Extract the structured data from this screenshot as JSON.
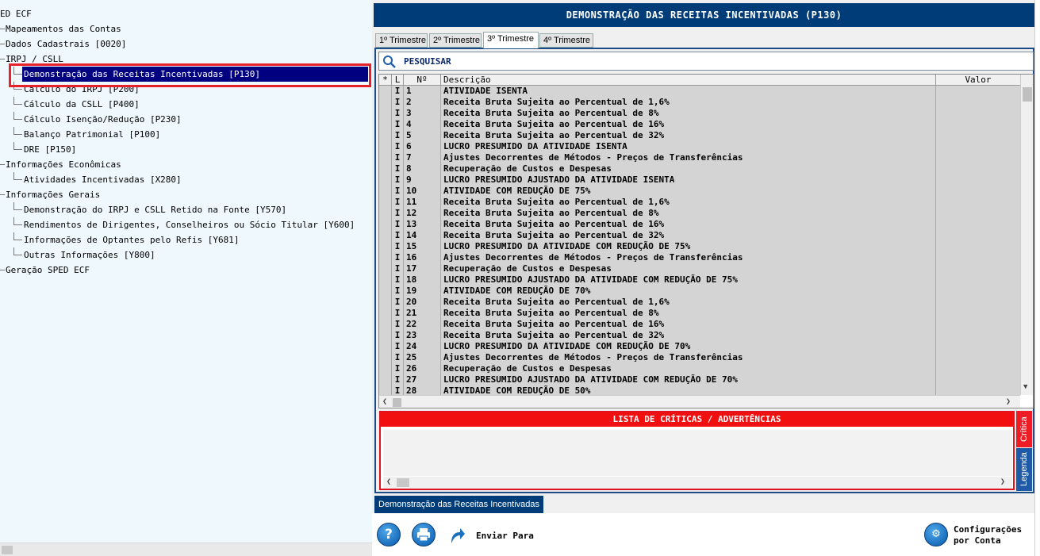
{
  "tree": {
    "nodes": [
      {
        "label": "ED ECF",
        "indent": 0
      },
      {
        "label": "Mapeamentos das Contas",
        "indent": 1
      },
      {
        "label": "Dados Cadastrais [0020]",
        "indent": 1
      },
      {
        "label": "IRPJ / CSLL",
        "indent": 1
      },
      {
        "label": "Demonstração das Receitas Incentivadas [P130]",
        "indent": 2,
        "selected": true
      },
      {
        "label": "Cálculo do IRPJ [P200]",
        "indent": 2
      },
      {
        "label": "Cálculo da CSLL [P400]",
        "indent": 2
      },
      {
        "label": "Cálculo Isenção/Redução [P230]",
        "indent": 2
      },
      {
        "label": "Balanço Patrimonial [P100]",
        "indent": 2
      },
      {
        "label": "DRE [P150]",
        "indent": 2
      },
      {
        "label": "Informações Econômicas",
        "indent": 1
      },
      {
        "label": "Atividades Incentivadas [X280]",
        "indent": 2
      },
      {
        "label": "Informações Gerais",
        "indent": 1
      },
      {
        "label": "Demonstração do IRPJ e CSLL Retido na Fonte [Y570]",
        "indent": 2
      },
      {
        "label": "Rendimentos de Dirigentes, Conselheiros ou Sócio Titular [Y600]",
        "indent": 2
      },
      {
        "label": "Informações de Optantes pelo Refis [Y681]",
        "indent": 2
      },
      {
        "label": "Outras Informações [Y800]",
        "indent": 2
      },
      {
        "label": "Geração SPED ECF",
        "indent": 1
      }
    ]
  },
  "panel": {
    "title": "DEMONSTRAÇÃO DAS RECEITAS INCENTIVADAS  (P130)",
    "tabs": [
      "1º Trimestre",
      "2º Trimestre",
      "3º Trimestre",
      "4º Trimestre"
    ],
    "active_tab_index": 2,
    "search_label": "PESQUISAR",
    "grid": {
      "headers": {
        "star": "*",
        "l": "L",
        "n": "Nº",
        "desc": "Descrição",
        "valor": "Valor"
      },
      "rows": [
        {
          "l": "I",
          "n": "1",
          "desc": "ATIVIDADE ISENTA"
        },
        {
          "l": "I",
          "n": "2",
          "desc": "Receita Bruta Sujeita ao Percentual de 1,6%"
        },
        {
          "l": "I",
          "n": "3",
          "desc": "Receita Bruta Sujeita ao Percentual de 8%"
        },
        {
          "l": "I",
          "n": "4",
          "desc": "Receita Bruta Sujeita ao Percentual de 16%"
        },
        {
          "l": "I",
          "n": "5",
          "desc": "Receita Bruta Sujeita ao Percentual de 32%"
        },
        {
          "l": "I",
          "n": "6",
          "desc": "LUCRO PRESUMIDO DA ATIVIDADE ISENTA"
        },
        {
          "l": "I",
          "n": "7",
          "desc": "Ajustes Decorrentes de Métodos - Preços de Transferências"
        },
        {
          "l": "I",
          "n": "8",
          "desc": "Recuperação de Custos e Despesas"
        },
        {
          "l": "I",
          "n": "9",
          "desc": "LUCRO PRESUMIDO AJUSTADO DA ATIVIDADE ISENTA"
        },
        {
          "l": "I",
          "n": "10",
          "desc": "ATIVIDADE COM REDUÇÃO DE 75%"
        },
        {
          "l": "I",
          "n": "11",
          "desc": "Receita Bruta Sujeita ao Percentual de 1,6%"
        },
        {
          "l": "I",
          "n": "12",
          "desc": "Receita Bruta Sujeita ao Percentual de 8%"
        },
        {
          "l": "I",
          "n": "13",
          "desc": "Receita Bruta Sujeita ao Percentual de 16%"
        },
        {
          "l": "I",
          "n": "14",
          "desc": "Receita Bruta Sujeita ao Percentual de 32%"
        },
        {
          "l": "I",
          "n": "15",
          "desc": "LUCRO PRESUMIDO DA ATIVIDADE COM REDUÇÃO DE 75%"
        },
        {
          "l": "I",
          "n": "16",
          "desc": "Ajustes Decorrentes de Métodos - Preços de Transferências"
        },
        {
          "l": "I",
          "n": "17",
          "desc": "Recuperação de Custos e Despesas"
        },
        {
          "l": "I",
          "n": "18",
          "desc": "LUCRO PRESUMIDO AJUSTADO DA ATIVIDADE COM REDUÇÃO DE 75%"
        },
        {
          "l": "I",
          "n": "19",
          "desc": "ATIVIDADE COM REDUÇÃO DE 70%"
        },
        {
          "l": "I",
          "n": "20",
          "desc": "Receita Bruta Sujeita ao Percentual de 1,6%"
        },
        {
          "l": "I",
          "n": "21",
          "desc": "Receita Bruta Sujeita ao Percentual de 8%"
        },
        {
          "l": "I",
          "n": "22",
          "desc": "Receita Bruta Sujeita ao Percentual de 16%"
        },
        {
          "l": "I",
          "n": "23",
          "desc": "Receita Bruta Sujeita ao Percentual de 32%"
        },
        {
          "l": "I",
          "n": "24",
          "desc": "LUCRO PRESUMIDO DA ATIVIDADE COM REDUÇÃO DE 70%"
        },
        {
          "l": "I",
          "n": "25",
          "desc": "Ajustes Decorrentes de Métodos - Preços de Transferências"
        },
        {
          "l": "I",
          "n": "26",
          "desc": "Recuperação de Custos e Despesas"
        },
        {
          "l": "I",
          "n": "27",
          "desc": "LUCRO PRESUMIDO AJUSTADO DA ATIVIDADE COM REDUÇÃO DE 70%"
        },
        {
          "l": "I",
          "n": "28",
          "desc": "ATIVIDADE COM REDUÇÃO DE 50%"
        }
      ]
    },
    "critics": {
      "title": "LISTA DE CRÍTICAS / ADVERTÊNCIAS",
      "tab_critica": "Crítica",
      "tab_legenda": "Legenda"
    },
    "bottom_tab": "Demonstração das Receitas Incentivadas",
    "toolbar": {
      "help_icon": "question-icon",
      "print_icon": "printer-icon",
      "send_label": "Enviar Para",
      "config_label_1": "Configurações",
      "config_label_2": "por Conta"
    }
  },
  "colors": {
    "title_bg": "#003d78",
    "selection_bg": "#000080",
    "highlight_border": "#e8202a",
    "critics_red": "#f10f10",
    "legend_blue": "#1e5aa8",
    "tree_bg": "#eef8fd"
  }
}
